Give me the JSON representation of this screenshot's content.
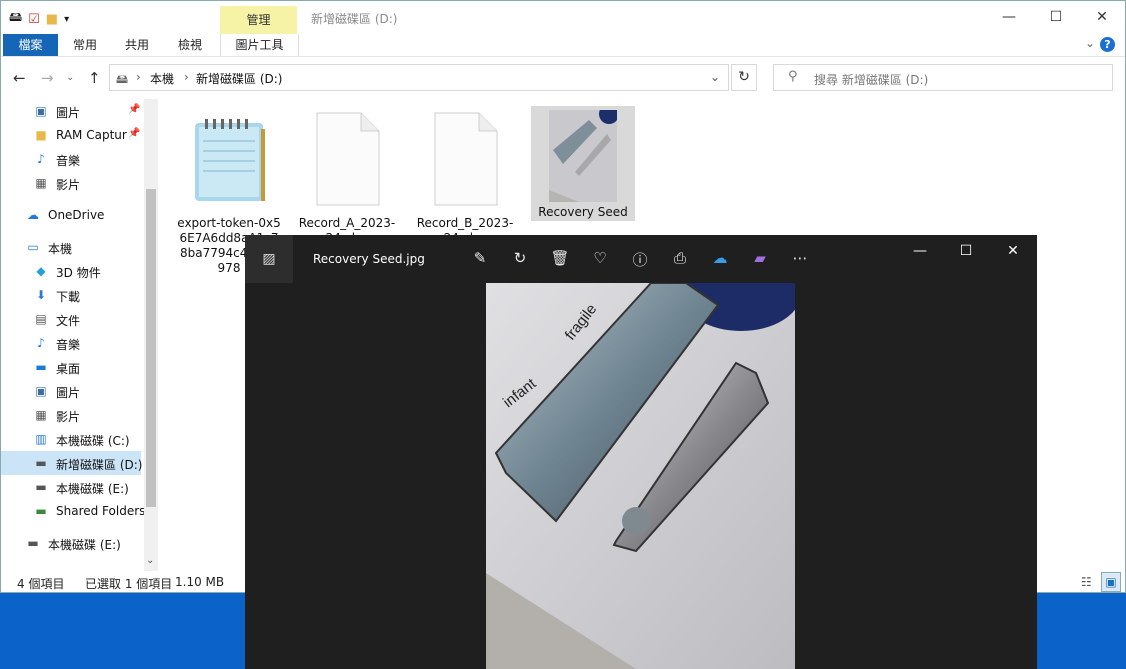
{
  "explorer": {
    "title": "新增磁碟區 (D:)",
    "manage_tab": "管理",
    "ribbon_tabs": [
      "檔案",
      "常用",
      "共用",
      "檢視",
      "圖片工具"
    ],
    "breadcrumb": [
      "本機",
      "新增磁碟區 (D:)"
    ],
    "search_placeholder": "搜尋 新增磁碟區 (D:)",
    "sidebar": [
      {
        "label": "圖片",
        "icon": "pictures-icon",
        "pinned": true
      },
      {
        "label": "RAM Captur",
        "icon": "folder-icon",
        "pinned": true
      },
      {
        "label": "音樂",
        "icon": "music-icon"
      },
      {
        "label": "影片",
        "icon": "videos-icon"
      },
      {
        "label": "OneDrive",
        "icon": "onedrive-icon"
      },
      {
        "label": "本機",
        "icon": "this-pc-icon"
      },
      {
        "label": "3D 物件",
        "icon": "3d-objects-icon"
      },
      {
        "label": "下載",
        "icon": "downloads-icon"
      },
      {
        "label": "文件",
        "icon": "documents-icon"
      },
      {
        "label": "音樂",
        "icon": "music-icon"
      },
      {
        "label": "桌面",
        "icon": "desktop-icon"
      },
      {
        "label": "圖片",
        "icon": "pictures-icon"
      },
      {
        "label": "影片",
        "icon": "videos-icon"
      },
      {
        "label": "本機磁碟 (C:)",
        "icon": "drive-c-icon"
      },
      {
        "label": "新增磁碟區 (D:)",
        "icon": "drive-icon",
        "selected": true
      },
      {
        "label": "本機磁碟 (E:)",
        "icon": "drive-icon"
      },
      {
        "label": "Shared Folders",
        "icon": "network-drive-icon"
      },
      {
        "label": "本機磁碟 (E:)",
        "icon": "drive-icon"
      }
    ],
    "files": [
      {
        "label": "export-token-0x56E7A6dd8aA1c78ba7794c43054978",
        "icon": "notepad-file-icon"
      },
      {
        "label": "Record_A_2023-24.xlsx",
        "icon": "blank-file-icon"
      },
      {
        "label": "Record_B_2023-24.xlsx",
        "icon": "blank-file-icon"
      },
      {
        "label": "Recovery Seed",
        "icon": "image-thumbnail-icon",
        "selected": true
      }
    ],
    "status": {
      "count": "4 個項目",
      "selected": "已選取 1 個項目",
      "size": "1.10 MB"
    }
  },
  "viewer": {
    "title": "Recovery Seed.jpg",
    "photo_text": [
      "fragile",
      "infant"
    ]
  },
  "colors": {
    "accent": "#1666b8",
    "manage_tab": "#f6f2a6",
    "viewer_bg": "#1f1f1f",
    "desktop": "#0b63c9"
  }
}
